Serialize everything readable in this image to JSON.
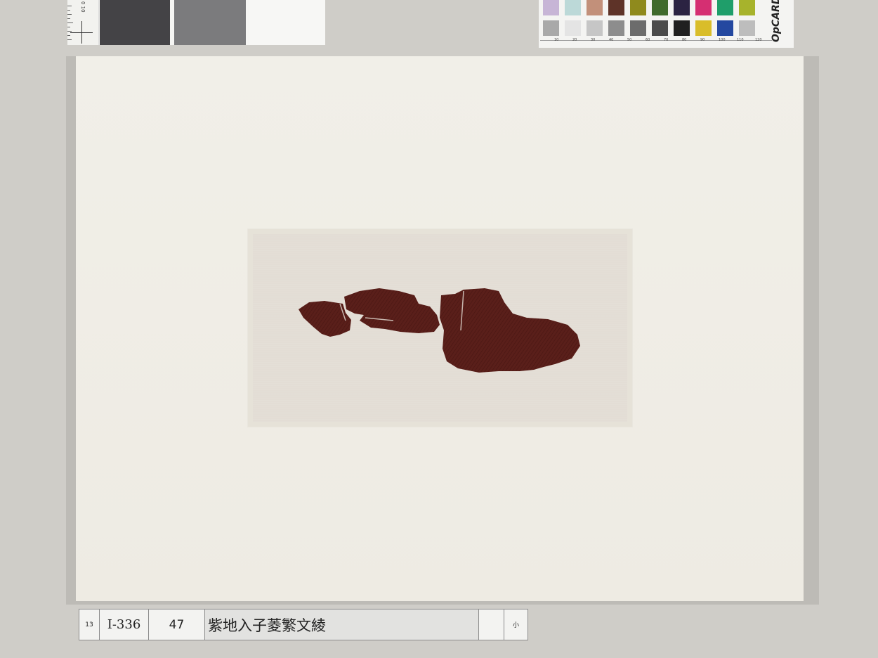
{
  "label": {
    "number": "13",
    "inventory_id": "I-336",
    "item_no": "47",
    "title": "紫地入子菱繁文綾",
    "blank": "",
    "size": "小"
  },
  "colors": {
    "background": "#cfcdc8",
    "mat": "#efece5",
    "window": "#e3ddd5",
    "fabric": "#5a1f1a"
  },
  "gray_swatches": [
    "#444346",
    "#7b7b7d",
    "#f7f7f5"
  ],
  "color_chips_top": [
    "#c7b5d6",
    "#bcd9d8",
    "#c2907a",
    "#5e3328",
    "#8f8a1d",
    "#3f6a2c",
    "#2b2342",
    "#d52f72",
    "#1f9e6a",
    "#a7b32c"
  ],
  "color_chips_bottom": [
    "#a9a9a9",
    "#e4e4e4",
    "#c6c6c6",
    "#8d8d8d",
    "#6c6c6c",
    "#4b4b4b",
    "#202020",
    "#d9bd2a",
    "#2448a0",
    "#bdbdbd"
  ],
  "scale_numbers": [
    "10",
    "20",
    "30",
    "40",
    "50",
    "60",
    "70",
    "80",
    "90",
    "100",
    "110",
    "120"
  ],
  "ruler_number": "0 10",
  "brand": "OpCARD",
  "icons": [
    "registration-cross-icon"
  ]
}
